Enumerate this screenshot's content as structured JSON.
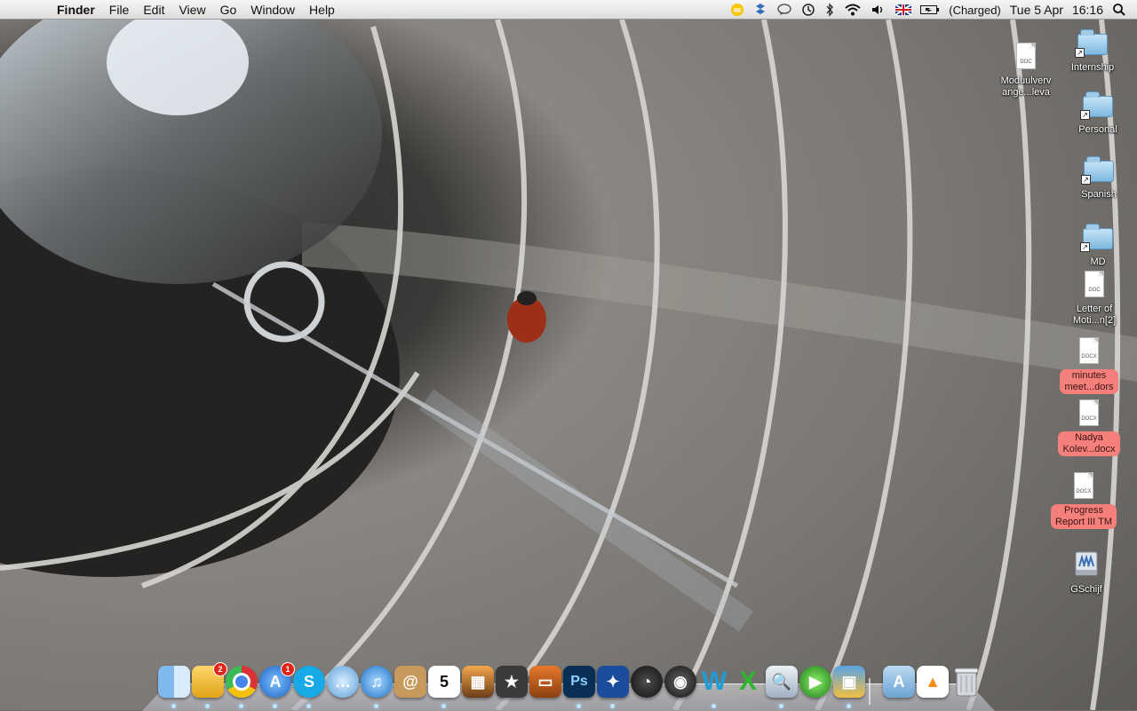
{
  "menubar": {
    "apple_glyph": "",
    "app_name": "Finder",
    "items": [
      "File",
      "Edit",
      "View",
      "Go",
      "Window",
      "Help"
    ],
    "status": {
      "battery_text": "(Charged)",
      "date": "Tue 5 Apr",
      "time": "16:16"
    }
  },
  "desktop": {
    "icons": [
      {
        "name": "Moduulverv\nange...leva",
        "kind": "doc",
        "tag": "DOC"
      },
      {
        "name": "Internship",
        "kind": "folder"
      },
      {
        "name": "Personal",
        "kind": "folder"
      },
      {
        "name": "Spanish",
        "kind": "folder"
      },
      {
        "name": "MD",
        "kind": "folder"
      },
      {
        "name": "Letter of\nMoti...n[2]",
        "kind": "doc",
        "tag": "DOC"
      },
      {
        "name": "minutes\nmeet...dors",
        "kind": "docx",
        "tag": "DOCX",
        "label_color": "#f47f7b"
      },
      {
        "name": "Nadya\nKolev...docx",
        "kind": "docx",
        "tag": "DOCX",
        "label_color": "#f47f7b"
      },
      {
        "name": "Progress\nReport III TM",
        "kind": "docx",
        "tag": "DOCX",
        "label_color": "#f47f7b"
      },
      {
        "name": "GSchijf",
        "kind": "drive"
      }
    ]
  },
  "dock": {
    "apps": [
      {
        "name": "finder",
        "badge": ""
      },
      {
        "name": "mail",
        "badge": "2"
      },
      {
        "name": "chrome",
        "badge": ""
      },
      {
        "name": "app-store",
        "badge": "1"
      },
      {
        "name": "skype",
        "badge": ""
      },
      {
        "name": "ichat",
        "badge": ""
      },
      {
        "name": "itunes",
        "badge": ""
      },
      {
        "name": "address-book",
        "badge": ""
      },
      {
        "name": "ical",
        "badge": "",
        "text": "5"
      },
      {
        "name": "iphoto",
        "badge": ""
      },
      {
        "name": "imovie",
        "badge": ""
      },
      {
        "name": "keynote",
        "badge": ""
      },
      {
        "name": "photoshop",
        "badge": "",
        "text": "Ps"
      },
      {
        "name": "vuze",
        "badge": ""
      },
      {
        "name": "dashboard",
        "badge": ""
      },
      {
        "name": "aperture",
        "badge": ""
      },
      {
        "name": "word",
        "badge": "",
        "text": "W"
      },
      {
        "name": "excel",
        "badge": "",
        "text": "X"
      },
      {
        "name": "preview",
        "badge": ""
      },
      {
        "name": "qt-green",
        "badge": ""
      },
      {
        "name": "photo-booth",
        "badge": ""
      },
      {
        "name": "applications-stack",
        "badge": ""
      },
      {
        "name": "vlc-document",
        "badge": ""
      },
      {
        "name": "trash",
        "badge": ""
      }
    ]
  },
  "colors": {
    "menubar_bg": "#e8e8e8",
    "label_red": "#f47f7b"
  }
}
